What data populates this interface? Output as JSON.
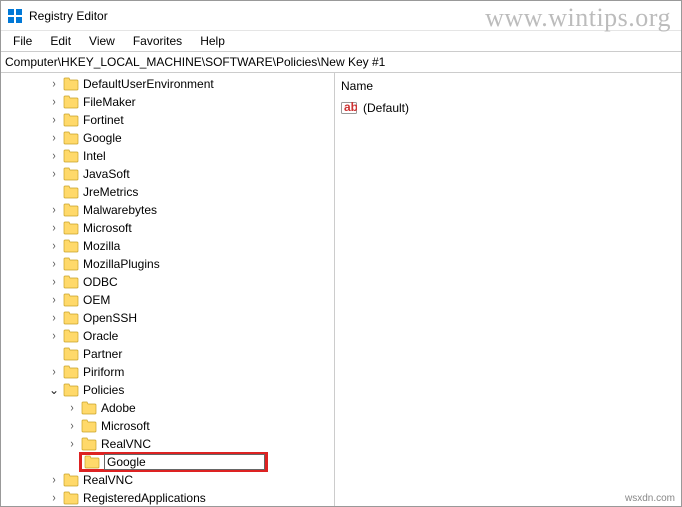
{
  "window": {
    "title": "Registry Editor"
  },
  "menu": {
    "file": "File",
    "edit": "Edit",
    "view": "View",
    "favorites": "Favorites",
    "help": "Help"
  },
  "address": {
    "path": "Computer\\HKEY_LOCAL_MACHINE\\SOFTWARE\\Policies\\New Key #1"
  },
  "tree": {
    "items": [
      {
        "indent": 46,
        "exp": ">",
        "label": "DefaultUserEnvironment"
      },
      {
        "indent": 46,
        "exp": ">",
        "label": "FileMaker"
      },
      {
        "indent": 46,
        "exp": ">",
        "label": "Fortinet"
      },
      {
        "indent": 46,
        "exp": ">",
        "label": "Google"
      },
      {
        "indent": 46,
        "exp": ">",
        "label": "Intel"
      },
      {
        "indent": 46,
        "exp": ">",
        "label": "JavaSoft"
      },
      {
        "indent": 46,
        "exp": "",
        "label": "JreMetrics"
      },
      {
        "indent": 46,
        "exp": ">",
        "label": "Malwarebytes"
      },
      {
        "indent": 46,
        "exp": ">",
        "label": "Microsoft"
      },
      {
        "indent": 46,
        "exp": ">",
        "label": "Mozilla"
      },
      {
        "indent": 46,
        "exp": ">",
        "label": "MozillaPlugins"
      },
      {
        "indent": 46,
        "exp": ">",
        "label": "ODBC"
      },
      {
        "indent": 46,
        "exp": ">",
        "label": "OEM"
      },
      {
        "indent": 46,
        "exp": ">",
        "label": "OpenSSH"
      },
      {
        "indent": 46,
        "exp": ">",
        "label": "Oracle"
      },
      {
        "indent": 46,
        "exp": "",
        "label": "Partner"
      },
      {
        "indent": 46,
        "exp": ">",
        "label": "Piriform"
      },
      {
        "indent": 46,
        "exp": "v",
        "label": "Policies"
      },
      {
        "indent": 64,
        "exp": ">",
        "label": "Adobe"
      },
      {
        "indent": 64,
        "exp": ">",
        "label": "Microsoft"
      },
      {
        "indent": 64,
        "exp": ">",
        "label": "RealVNC"
      },
      {
        "indent": 64,
        "exp": "",
        "label": "Google",
        "editing": true,
        "highlight": true
      },
      {
        "indent": 46,
        "exp": ">",
        "label": "RealVNC"
      },
      {
        "indent": 46,
        "exp": ">",
        "label": "RegisteredApplications"
      }
    ]
  },
  "values": {
    "header_name": "Name",
    "default_label": "(Default)"
  },
  "watermark": "www.wintips.org",
  "credit": "wsxdn.com"
}
